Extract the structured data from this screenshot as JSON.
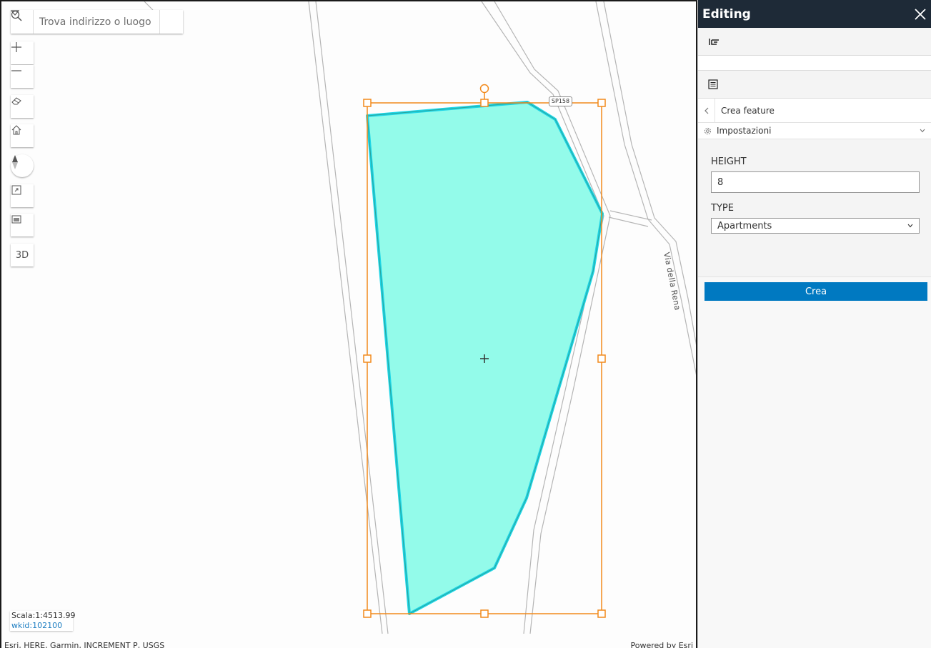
{
  "map": {
    "search": {
      "placeholder": "Trova indirizzo o luogo"
    },
    "controls": [
      {
        "name": "zoom-in-button",
        "icon": "plus-icon"
      },
      {
        "name": "zoom-out-button",
        "icon": "minus-icon"
      },
      {
        "name": "eraser-button",
        "icon": "eraser-icon"
      },
      {
        "name": "home-button",
        "icon": "home-icon"
      },
      {
        "name": "compass-button",
        "icon": "compass-icon"
      },
      {
        "name": "fullscreen-button",
        "icon": "expand-icon"
      },
      {
        "name": "basemap-button",
        "icon": "basemap-icon"
      },
      {
        "name": "3d-button",
        "label": "3D"
      }
    ],
    "scale_text": "Scala:1:4513.99",
    "wkid_text": "wkid:102100",
    "attribution": "Esri, HERE, Garmin, INCREMENT P, USGS",
    "powered_by": "Powered by Esri",
    "road_label": "Via della Rena",
    "road_shield": "SP158",
    "colors": {
      "polygon_fill": "#93fbea",
      "polygon_outline": "#1fd6e6",
      "selection": "#f28a1c"
    }
  },
  "panel": {
    "title": "Editing",
    "nav_label": "Crea feature",
    "settings_label": "Impostazioni",
    "fields": {
      "height_label": "HEIGHT",
      "height_value": "8",
      "type_label": "TYPE",
      "type_value": "Apartments"
    },
    "create_button": "Crea",
    "colors": {
      "header": "#1e2a37",
      "button": "#0079c1"
    }
  }
}
